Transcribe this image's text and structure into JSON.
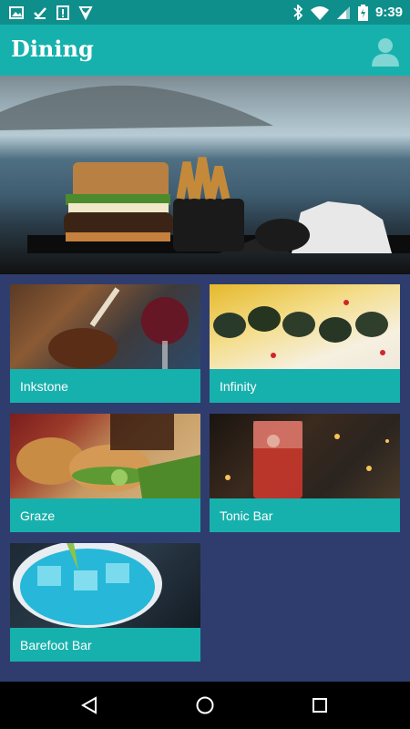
{
  "status_bar": {
    "time": "9:39"
  },
  "app_bar": {
    "title": "Dining"
  },
  "venues": [
    {
      "name": "Inkstone"
    },
    {
      "name": "Infinity"
    },
    {
      "name": "Graze"
    },
    {
      "name": "Tonic Bar"
    },
    {
      "name": "Barefoot Bar"
    }
  ],
  "colors": {
    "primary": "#17b1ad",
    "status": "#0f8f8b",
    "background": "#2f3d6e"
  },
  "icons": [
    "image-icon",
    "check-icon",
    "notification-icon",
    "download-icon",
    "bluetooth-icon",
    "wifi-icon",
    "signal-icon",
    "battery-icon",
    "profile-icon",
    "back-icon",
    "home-icon",
    "recents-icon"
  ]
}
